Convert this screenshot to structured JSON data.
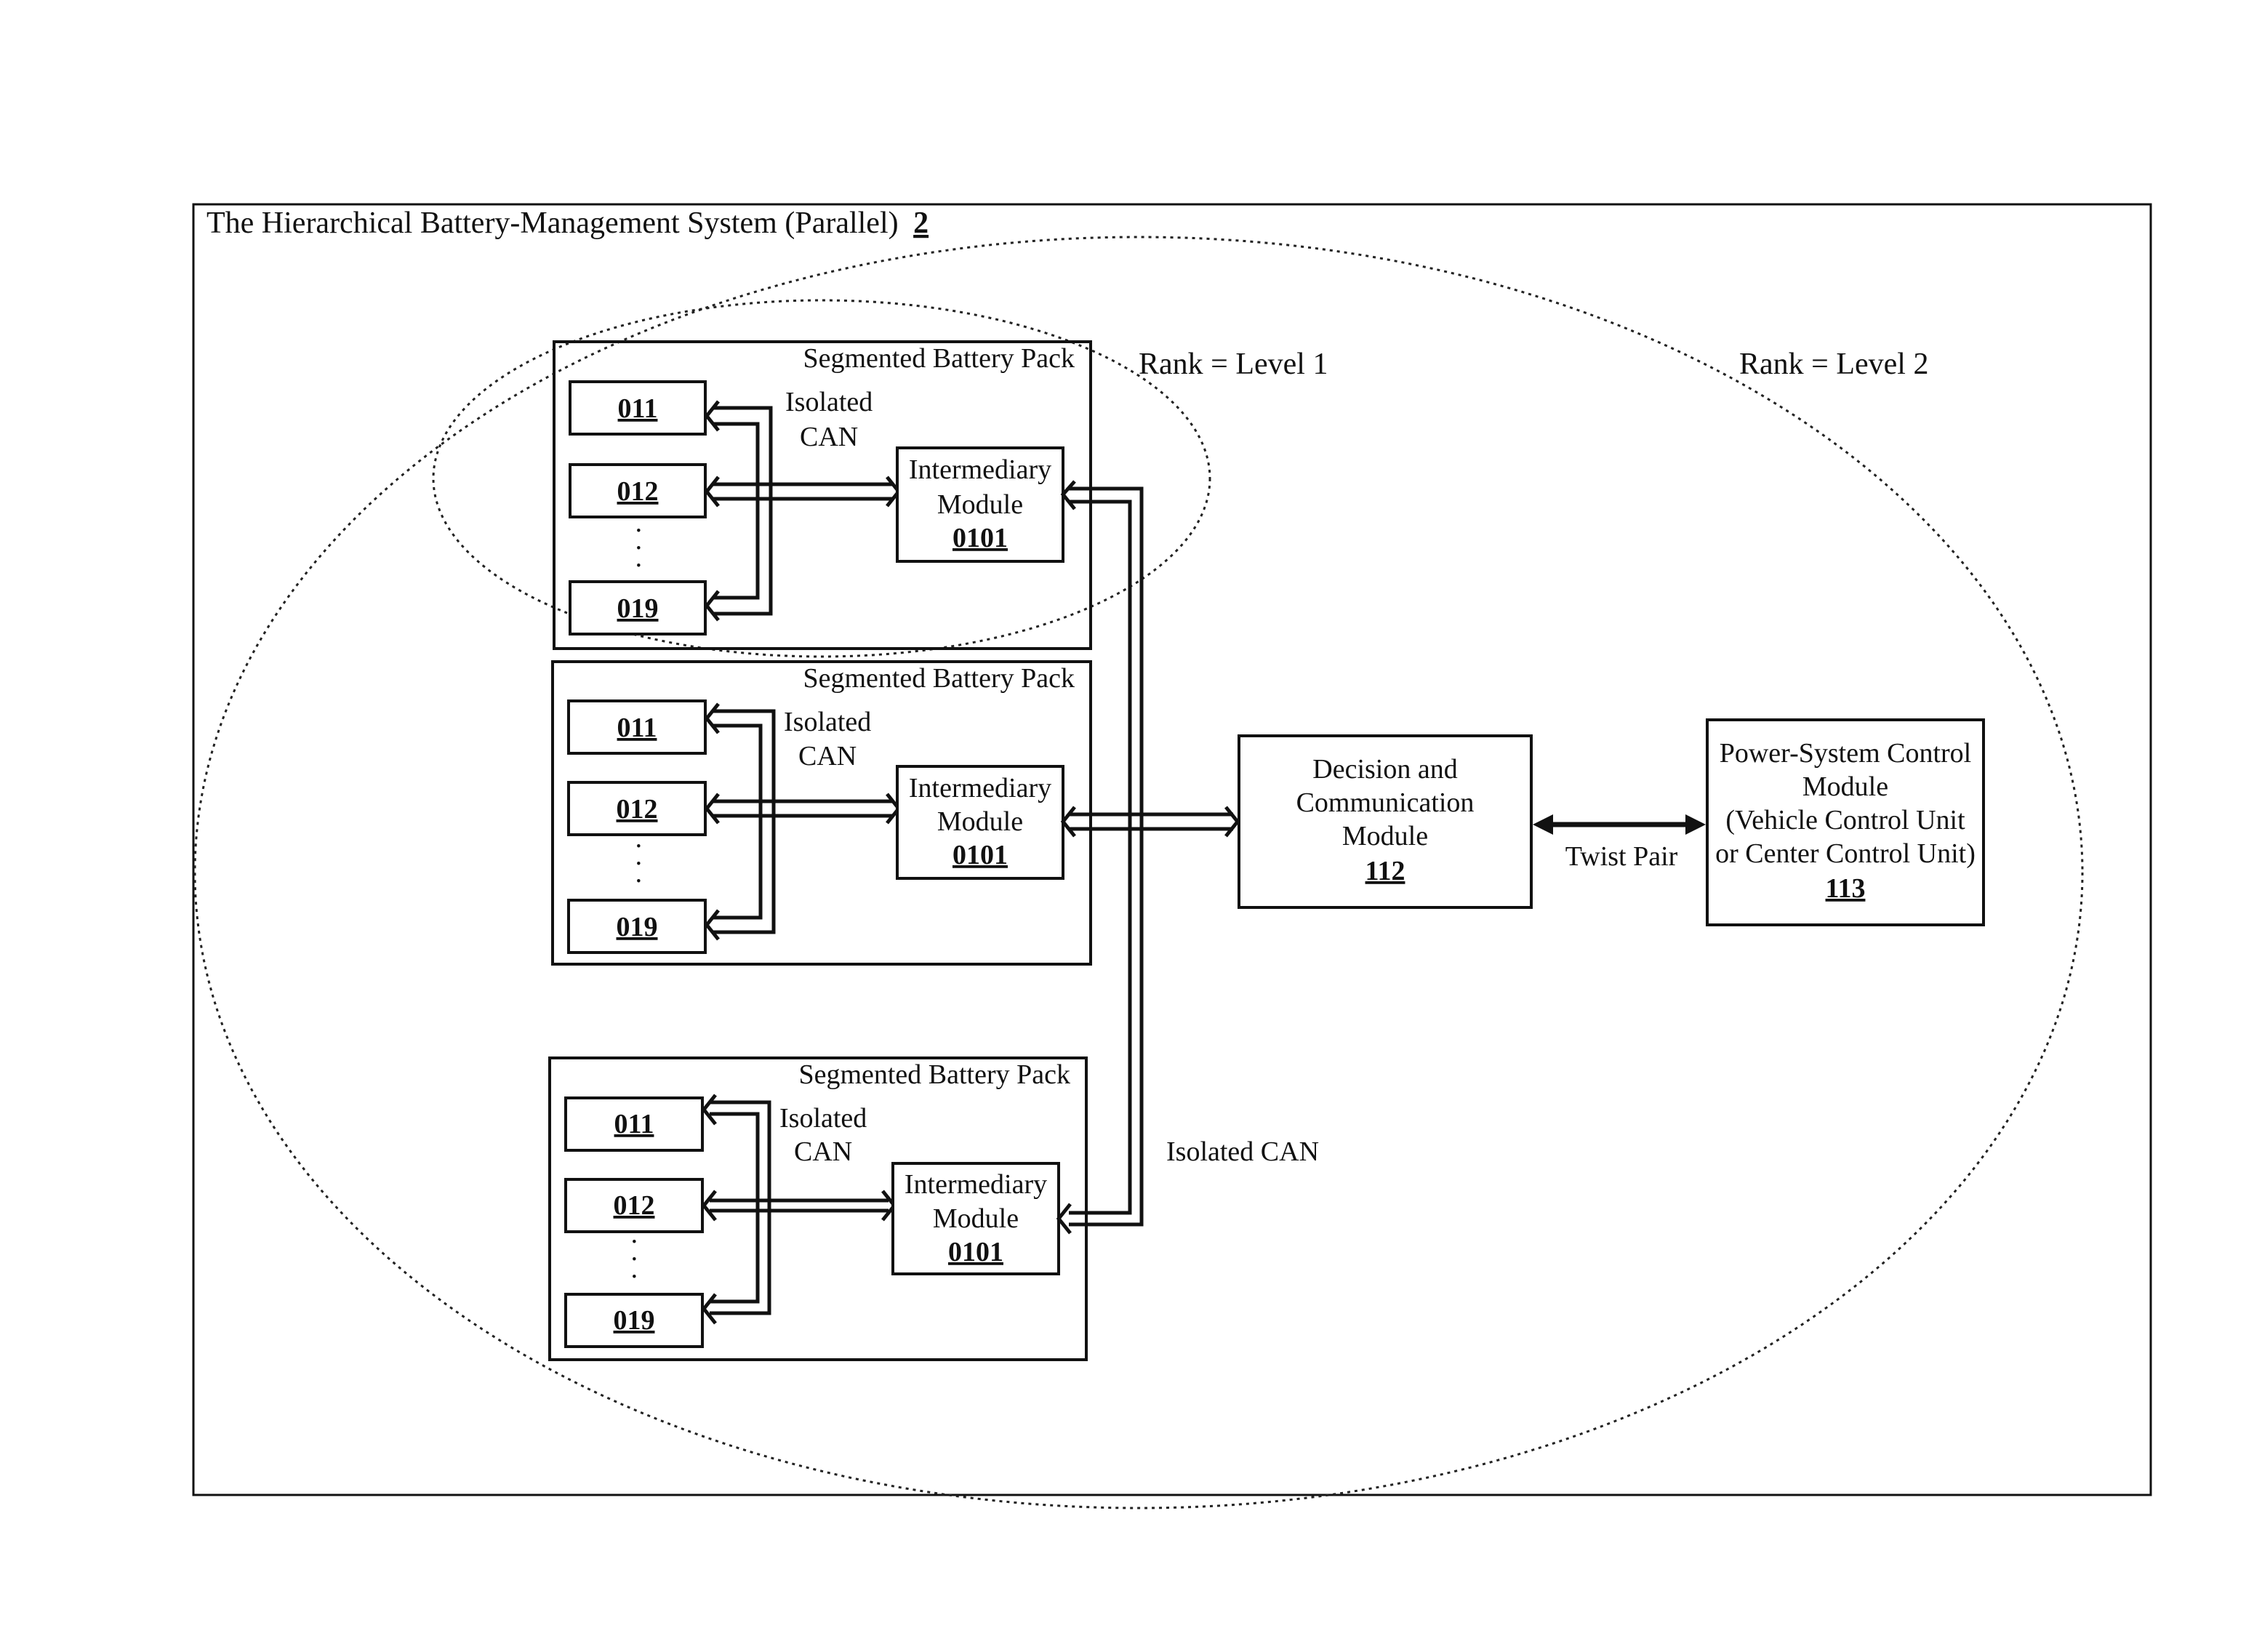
{
  "diagram": {
    "title": "The Hierarchical Battery-Management System (Parallel)",
    "title_ref": "2",
    "rank_level_1": "Rank = Level 1",
    "rank_level_2": "Rank = Level 2",
    "packs": [
      {
        "label": "Segmented Battery Pack",
        "cells": [
          "011",
          "012",
          "019"
        ],
        "bus_label_line1": "Isolated",
        "bus_label_line2": "CAN",
        "module_line1": "Intermediary",
        "module_line2": "Module",
        "module_ref": "0101"
      },
      {
        "label": "Segmented Battery Pack",
        "cells": [
          "011",
          "012",
          "019"
        ],
        "bus_label_line1": "Isolated",
        "bus_label_line2": "CAN",
        "module_line1": "Intermediary",
        "module_line2": "Module",
        "module_ref": "0101"
      },
      {
        "label": "Segmented Battery Pack",
        "cells": [
          "011",
          "012",
          "019"
        ],
        "bus_label_line1": "Isolated",
        "bus_label_line2": "CAN",
        "module_line1": "Intermediary",
        "module_line2": "Module",
        "module_ref": "0101"
      }
    ],
    "main_bus_label": "Isolated CAN",
    "decision_module": {
      "line1": "Decision and",
      "line2": "Communication",
      "line3": "Module",
      "ref": "112"
    },
    "link_label": "Twist Pair",
    "power_module": {
      "line1": "Power-System Control",
      "line2": "Module",
      "line3": "(Vehicle Control Unit",
      "line4": "or Center Control Unit)",
      "ref": "113"
    }
  }
}
